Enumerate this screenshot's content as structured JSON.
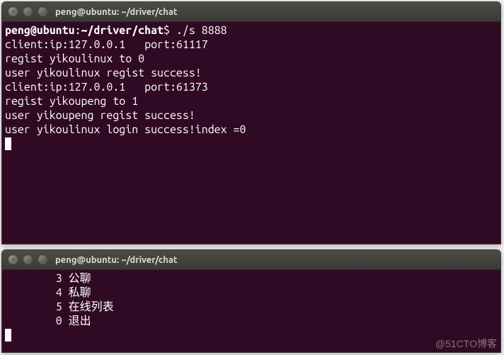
{
  "terminal1": {
    "title": "peng@ubuntu: ~/driver/chat",
    "prompt": {
      "userhost": "peng@ubuntu",
      "path": "~/driver/chat",
      "dollar": "$",
      "command": "./s 8888"
    },
    "lines": [
      "client:ip:127.0.0.1   port:61117",
      "regist yikoulinux to 0",
      "user yikoulinux regist success!",
      "client:ip:127.0.0.1   port:61373",
      "regist yikoupeng to 1",
      "user yikoupeng regist success!",
      "user yikoulinux login success!index =0"
    ]
  },
  "terminal2": {
    "title": "peng@ubuntu: ~/driver/chat",
    "menu": [
      {
        "num": "3",
        "label": "公聊"
      },
      {
        "num": "4",
        "label": "私聊"
      },
      {
        "num": "5",
        "label": "在线列表"
      },
      {
        "num": "0",
        "label": "退出"
      }
    ]
  },
  "watermark": "@51CTO博客"
}
